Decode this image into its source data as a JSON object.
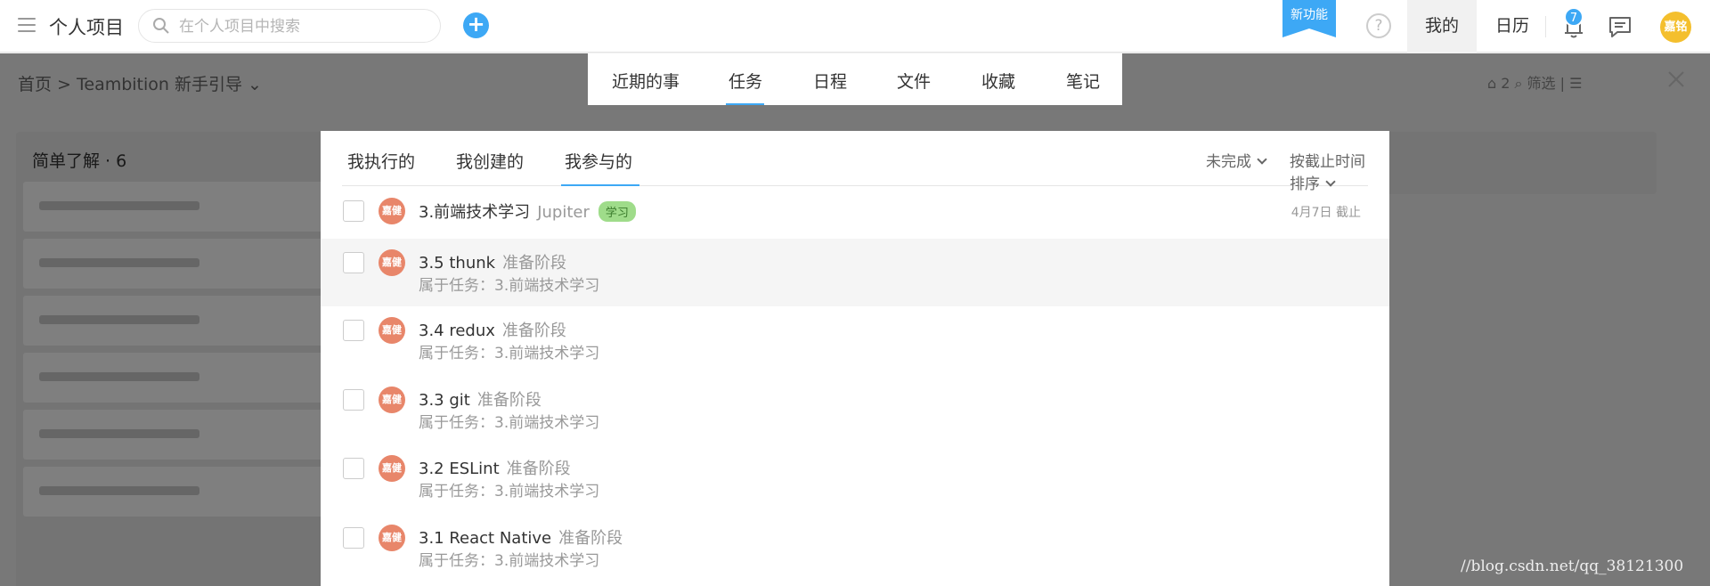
{
  "topbar": {
    "project_title": "个人项目",
    "search_placeholder": "在个人项目中搜索",
    "add_label": "+",
    "new_feature_label": "新功能",
    "help_label": "?",
    "nav_mine": "我的",
    "nav_calendar": "日历",
    "notification_count": "7",
    "user_avatar_text": "嘉铭",
    "accent_color": "#3da8f5"
  },
  "background": {
    "breadcrumb": "首页 > Teambition 新手引导 ⌄",
    "column_title": "简单了解 · 6",
    "right_toolbar": "⌂ 2  ⌕ 筛选  |  ☰"
  },
  "module_tabs": [
    {
      "label": "近期的事"
    },
    {
      "label": "任务"
    },
    {
      "label": "日程"
    },
    {
      "label": "文件"
    },
    {
      "label": "收藏"
    },
    {
      "label": "笔记"
    }
  ],
  "sub_tabs": [
    {
      "label": "我执行的"
    },
    {
      "label": "我创建的"
    },
    {
      "label": "我参与的"
    }
  ],
  "filters": {
    "status": "未完成",
    "sort": "按截止时间排序"
  },
  "tasks": [
    {
      "title": "3.前端技术学习",
      "project": "Jupiter",
      "tag": "学习",
      "due": "4月7日 截止",
      "avatar": "嘉健"
    },
    {
      "title": "3.5 thunk",
      "stage": "准备阶段",
      "parent": "属于任务：3.前端技术学习",
      "avatar": "嘉健"
    },
    {
      "title": "3.4 redux",
      "stage": "准备阶段",
      "parent": "属于任务：3.前端技术学习",
      "avatar": "嘉健"
    },
    {
      "title": "3.3 git",
      "stage": "准备阶段",
      "parent": "属于任务：3.前端技术学习",
      "avatar": "嘉健"
    },
    {
      "title": "3.2 ESLint",
      "stage": "准备阶段",
      "parent": "属于任务：3.前端技术学习",
      "avatar": "嘉健"
    },
    {
      "title": "3.1 React Native",
      "stage": "准备阶段",
      "parent": "属于任务：3.前端技术学习",
      "avatar": "嘉健"
    }
  ],
  "watermark": "//blog.csdn.net/qq_38121300"
}
